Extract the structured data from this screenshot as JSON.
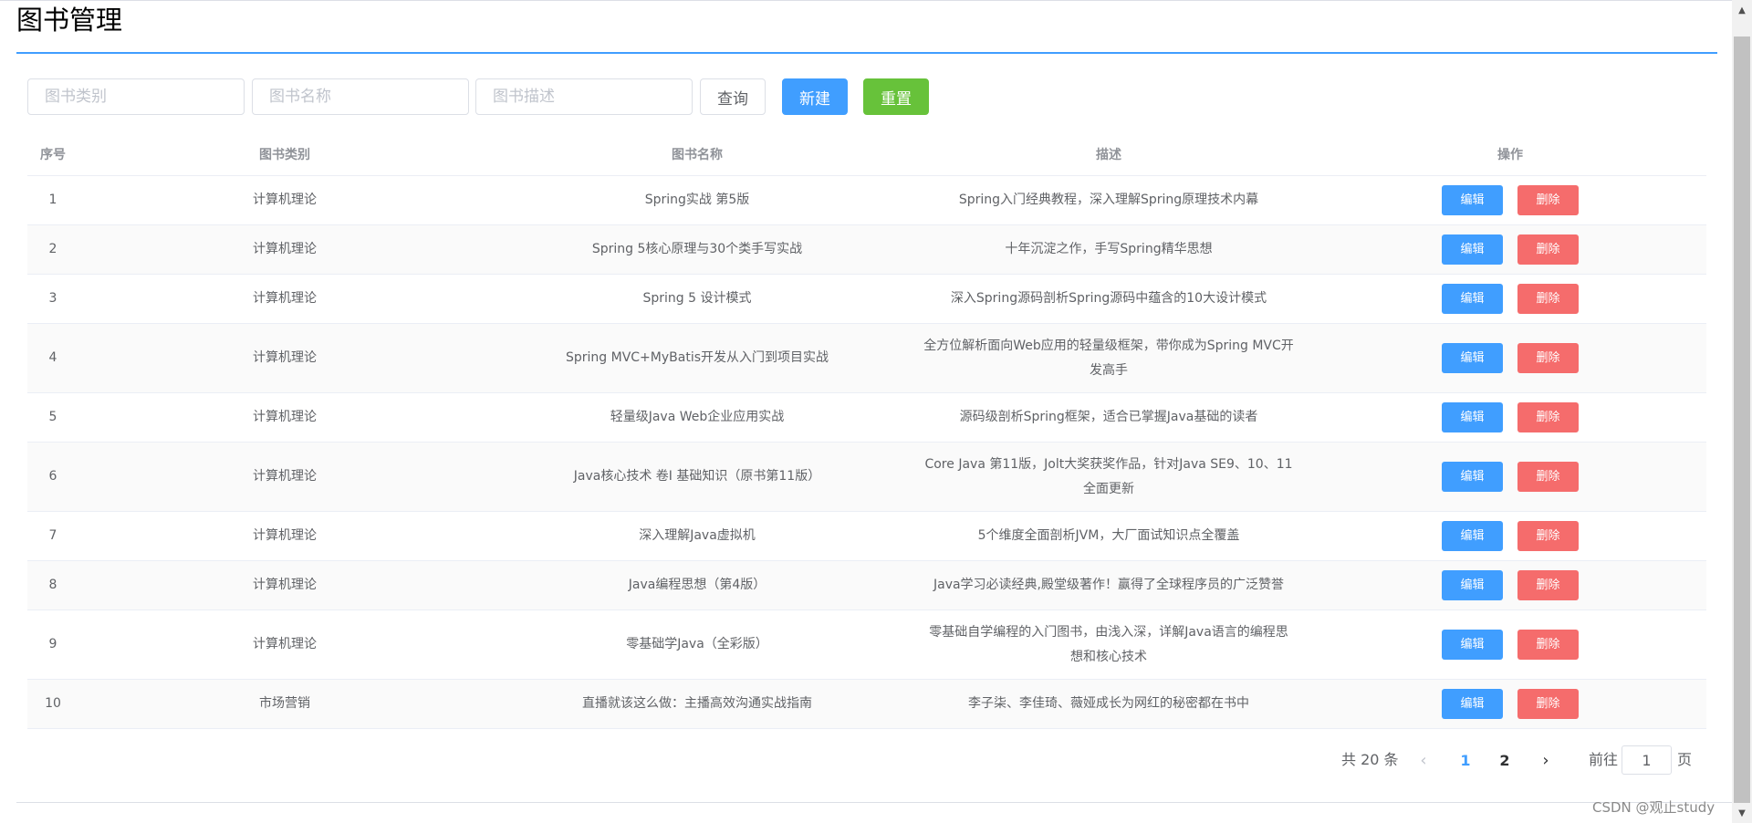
{
  "page": {
    "title": "图书管理"
  },
  "search": {
    "category_placeholder": "图书类别",
    "name_placeholder": "图书名称",
    "desc_placeholder": "图书描述",
    "query_label": "查询",
    "create_label": "新建",
    "reset_label": "重置"
  },
  "table": {
    "headers": {
      "index": "序号",
      "category": "图书类别",
      "name": "图书名称",
      "desc": "描述",
      "ops": "操作"
    },
    "edit_label": "编辑",
    "delete_label": "删除",
    "rows": [
      {
        "index": "1",
        "category": "计算机理论",
        "name": "Spring实战 第5版",
        "desc": "Spring入门经典教程，深入理解Spring原理技术内幕"
      },
      {
        "index": "2",
        "category": "计算机理论",
        "name": "Spring 5核心原理与30个类手写实战",
        "desc": "十年沉淀之作，手写Spring精华思想"
      },
      {
        "index": "3",
        "category": "计算机理论",
        "name": "Spring 5 设计模式",
        "desc": "深入Spring源码剖析Spring源码中蕴含的10大设计模式"
      },
      {
        "index": "4",
        "category": "计算机理论",
        "name": "Spring MVC+MyBatis开发从入门到项目实战",
        "desc": "全方位解析面向Web应用的轻量级框架，带你成为Spring MVC开发高手"
      },
      {
        "index": "5",
        "category": "计算机理论",
        "name": "轻量级Java Web企业应用实战",
        "desc": "源码级剖析Spring框架，适合已掌握Java基础的读者"
      },
      {
        "index": "6",
        "category": "计算机理论",
        "name": "Java核心技术 卷I 基础知识（原书第11版）",
        "desc": "Core Java 第11版，Jolt大奖获奖作品，针对Java SE9、10、11全面更新"
      },
      {
        "index": "7",
        "category": "计算机理论",
        "name": "深入理解Java虚拟机",
        "desc": "5个维度全面剖析JVM，大厂面试知识点全覆盖"
      },
      {
        "index": "8",
        "category": "计算机理论",
        "name": "Java编程思想（第4版）",
        "desc": "Java学习必读经典,殿堂级著作！赢得了全球程序员的广泛赞誉"
      },
      {
        "index": "9",
        "category": "计算机理论",
        "name": "零基础学Java（全彩版）",
        "desc": "零基础自学编程的入门图书，由浅入深，详解Java语言的编程思想和核心技术"
      },
      {
        "index": "10",
        "category": "市场营销",
        "name": "直播就该这么做：主播高效沟通实战指南",
        "desc": "李子柒、李佳琦、薇娅成长为网红的秘密都在书中"
      }
    ]
  },
  "pagination": {
    "total_text": "共 20 条",
    "pages": [
      "1",
      "2"
    ],
    "current": "1",
    "goto_label": "前往",
    "goto_value": "1",
    "page_suffix": "页",
    "prev_icon": "chevron-left-icon",
    "next_icon": "chevron-right-icon"
  },
  "watermark": "CSDN @观止study",
  "colors": {
    "primary": "#409eff",
    "success": "#67c23a",
    "danger": "#f56c6c",
    "border": "#dcdfe6"
  }
}
